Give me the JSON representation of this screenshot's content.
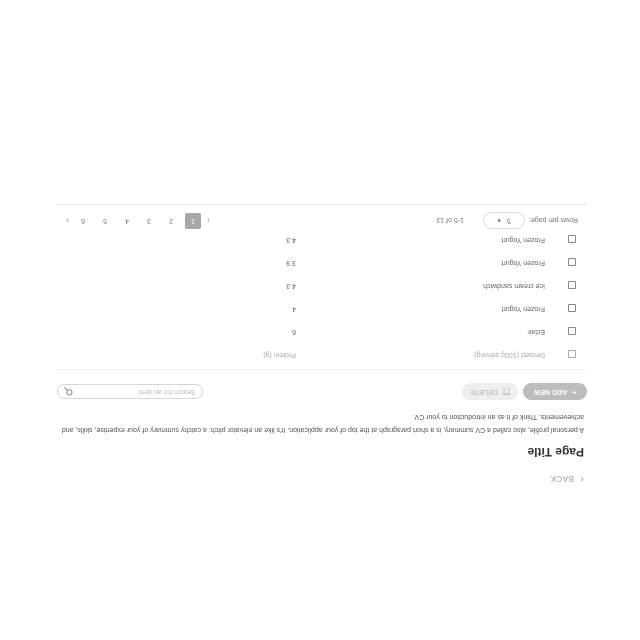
{
  "header": {
    "back_label": "BACK",
    "title": "Page Title",
    "description": "A personal profile, also called a CV summary, is a short paragraph at the top of your application. It's like an elevator pitch: a catchy summary of your expertise, skills, and achievements. Think of it as an introduction to your CV."
  },
  "toolbar": {
    "add_label": "ADD NEW",
    "delete_label": "DELETE",
    "search_placeholder": "Search for an item"
  },
  "table": {
    "header": {
      "name": "Dessert (100g serving)",
      "value": "Protein (g)"
    },
    "rows": [
      {
        "name": "Eclair",
        "value": "6"
      },
      {
        "name": "Frozen Yogurt",
        "value": "4"
      },
      {
        "name": "Ice cream sandwich",
        "value": "4.3"
      },
      {
        "name": "Frozen Yogurt",
        "value": "3.9"
      },
      {
        "name": "Frozen Yogurt",
        "value": "4.3"
      }
    ]
  },
  "pagination": {
    "rows_per_page_label": "Rows per page:",
    "rows_per_page_value": "5",
    "range_label": "1-5 of 13",
    "pages": [
      "1",
      "2",
      "3",
      "4",
      "5",
      "6"
    ],
    "current_page": "1"
  },
  "colors": {
    "accent_gray": "#a8a8a8"
  }
}
